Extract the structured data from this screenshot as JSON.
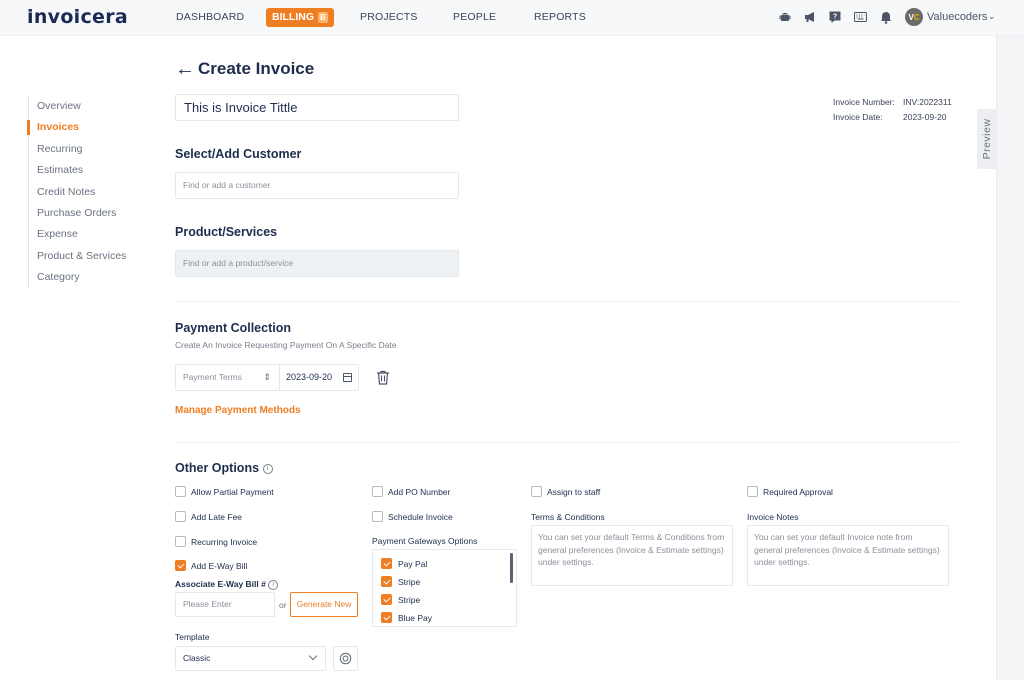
{
  "brand": {
    "logo_text": "invoicera",
    "accent": "#ef7d22",
    "navy": "#1f2d4d"
  },
  "topnav": {
    "items": [
      {
        "label": "DASHBOARD"
      },
      {
        "label": "BILLING",
        "badge": "B",
        "active": true
      },
      {
        "label": "PROJECTS"
      },
      {
        "label": "PEOPLE"
      },
      {
        "label": "REPORTS"
      }
    ],
    "icons": [
      "android-icon",
      "megaphone-icon",
      "help-icon",
      "keyboard-icon",
      "bell-icon"
    ],
    "user": {
      "initials_v": "V",
      "initials_c": "C",
      "name": "Valuecoders",
      "chevron": "⌄"
    }
  },
  "sidebar": {
    "items": [
      {
        "label": "Overview"
      },
      {
        "label": "Invoices",
        "active": true
      },
      {
        "label": "Recurring"
      },
      {
        "label": "Estimates"
      },
      {
        "label": "Credit Notes"
      },
      {
        "label": "Purchase Orders"
      },
      {
        "label": "Expense"
      },
      {
        "label": "Product & Services"
      },
      {
        "label": "Category"
      }
    ]
  },
  "page": {
    "back_arrow": "←",
    "title": "Create Invoice",
    "invoice_title_value": "This is Invoice Tittle",
    "meta": {
      "number_label": "Invoice Number:",
      "number_value": "INV:2022311",
      "date_label": "Invoice Date:",
      "date_value": "2023-09-20"
    },
    "preview_label": "Preview"
  },
  "customer": {
    "heading": "Select/Add Customer",
    "placeholder": "Find or add a customer"
  },
  "products": {
    "heading": "Product/Services",
    "placeholder": "Find or add a product/service"
  },
  "payment": {
    "heading": "Payment Collection",
    "subtitle": "Create An Invoice Requesting Payment On A Specific Date",
    "terms_placeholder": "Payment Terms",
    "terms_updown": "⇕",
    "date_value": "2023-09-20",
    "manage_link": "Manage Payment Methods"
  },
  "options": {
    "heading": "Other Options",
    "info": "i",
    "col1": [
      {
        "label": "Allow Partial Payment",
        "checked": false
      },
      {
        "label": "Add Late Fee",
        "checked": false
      },
      {
        "label": "Recurring Invoice",
        "checked": false
      },
      {
        "label": "Add E-Way Bill",
        "checked": true
      }
    ],
    "col2": [
      {
        "label": "Add PO Number",
        "checked": false
      },
      {
        "label": "Schedule Invoice",
        "checked": false
      }
    ],
    "assign_staff": {
      "label": "Assign to staff",
      "checked": false
    },
    "required_approval": {
      "label": "Required Approval",
      "checked": false
    },
    "eway": {
      "label": "Associate E-Way Bill #",
      "placeholder": "Please Enter",
      "or": "or",
      "generate_label": "Generate New"
    },
    "template": {
      "label": "Template",
      "value": "Classic"
    },
    "gateways": {
      "label": "Payment Gateways Options",
      "items": [
        {
          "label": "Pay Pal",
          "checked": true
        },
        {
          "label": "Stripe",
          "checked": true
        },
        {
          "label": "Stripe",
          "checked": true
        },
        {
          "label": "Blue Pay",
          "checked": true
        }
      ]
    },
    "terms_conditions": {
      "label": "Terms & Conditions",
      "placeholder": "You can set your default Terms & Conditions from general preferences (Invoice & Estimate settings) under settings."
    },
    "invoice_notes": {
      "label": "Invoice Notes",
      "placeholder": "You can set your default Invoice note from general preferences (Invoice & Estimate settings) under settings."
    }
  }
}
